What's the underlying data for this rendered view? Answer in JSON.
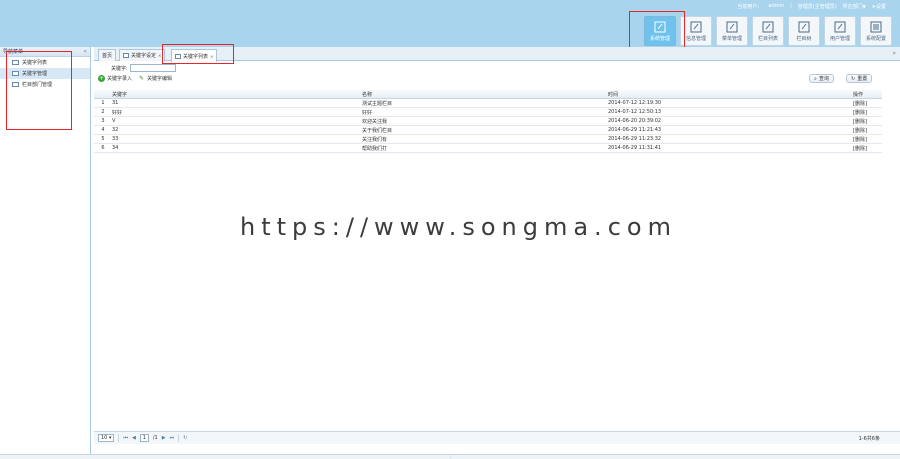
{
  "header": {
    "user": {
      "greeting": "当前用户：",
      "username": "admin",
      "separator": "|",
      "role": "管理员(主管理员)",
      "dept": "所在部门",
      "settings": "设置"
    },
    "modules": [
      {
        "label": "系统管理",
        "icon": "edit-icon",
        "active": true
      },
      {
        "label": "信息管理",
        "icon": "edit-icon"
      },
      {
        "label": "菜单管理",
        "icon": "edit-icon"
      },
      {
        "label": "栏目列表",
        "icon": "edit-icon"
      },
      {
        "label": "栏目树",
        "icon": "edit-icon"
      },
      {
        "label": "用户管理",
        "icon": "edit-icon"
      },
      {
        "label": "系统配置",
        "icon": "list-icon"
      }
    ]
  },
  "sidebar": {
    "title": "导航菜单",
    "items": [
      {
        "label": "关键字列表"
      },
      {
        "label": "关键字管理",
        "selected": true
      },
      {
        "label": "栏目部门管理"
      }
    ]
  },
  "tabs": [
    {
      "label": "首页"
    },
    {
      "label": "关键字设定"
    },
    {
      "label": "关键字列表",
      "active": true
    }
  ],
  "search": {
    "label": "关键字:",
    "value": ""
  },
  "actions": {
    "add": "关键字录入",
    "edit": "关键字编辑",
    "query": "查询",
    "reset": "重置"
  },
  "table": {
    "columns": [
      "",
      "关键字",
      "名称",
      "时间",
      "操作"
    ],
    "rows": [
      {
        "num": "1",
        "key": "31",
        "name": "测试主题栏目",
        "time": "2014-07-12 12:19:30",
        "op": "[删除]"
      },
      {
        "num": "2",
        "key": "好好",
        "name": "好好",
        "time": "2014-07-12 12:50:13",
        "op": "[删除]"
      },
      {
        "num": "3",
        "key": "V",
        "name": "欢迎关注我",
        "time": "2014-06-20 20:39:02",
        "op": "[删除]"
      },
      {
        "num": "4",
        "key": "32",
        "name": "关于我们栏目",
        "time": "2014-06-29 11:21:43",
        "op": "[删除]"
      },
      {
        "num": "5",
        "key": "33",
        "name": "关注我们有",
        "time": "2014-06-29 11:23:32",
        "op": "[删除]"
      },
      {
        "num": "6",
        "key": "34",
        "name": "帮助我们打",
        "time": "2014-06-29 11:31:41",
        "op": "[删除]"
      }
    ]
  },
  "pager": {
    "page_size": "10",
    "current": "1",
    "total": "/1",
    "info": "1-6共6条"
  },
  "watermark": "https://www.songma.com"
}
